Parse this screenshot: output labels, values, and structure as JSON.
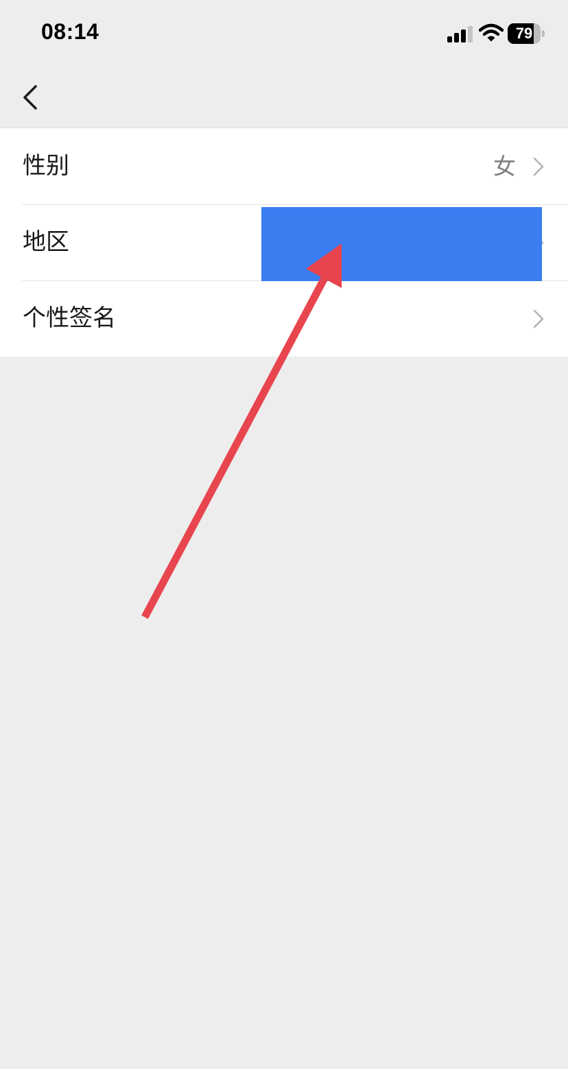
{
  "status_bar": {
    "time": "08:14",
    "battery_level": "79",
    "battery_fraction": 0.79,
    "signal_bars_active": 3,
    "signal_bars_total": 4,
    "icons": [
      "signal-icon",
      "wifi-icon",
      "battery-icon"
    ]
  },
  "nav": {
    "back_icon": "chevron-left-icon"
  },
  "rows": [
    {
      "label": "性别",
      "value": "女"
    },
    {
      "label": "地区",
      "value": ""
    },
    {
      "label": "个性签名",
      "value": ""
    }
  ],
  "colors": {
    "background": "#ededed",
    "list_background": "#ffffff",
    "redaction": "#3b7ef1",
    "annotation_arrow": "#e8454f"
  }
}
